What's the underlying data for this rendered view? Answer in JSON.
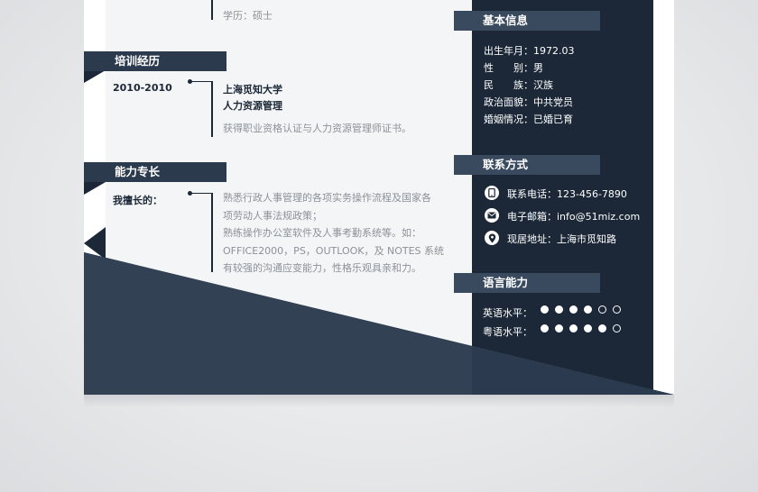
{
  "education": {
    "degree": "学历：硕士"
  },
  "training": {
    "title": "培训经历",
    "date": "2010-2010",
    "school": "上海觅知大学",
    "major": "人力资源管理",
    "desc": "获得职业资格认证与人力资源管理师证书。"
  },
  "skills": {
    "title": "能力专长",
    "label": "我擅长的：",
    "lines": [
      "熟悉行政人事管理的各项实务操作流程及国家各",
      "项劳动人事法规政策；",
      "熟练操作办公室软件及人事考勤系统等。如：",
      "OFFICE2000，PS，OUTLOOK，及 NOTES 系统",
      "有较强的沟通应变能力，性格乐观具亲和力。"
    ]
  },
  "basic": {
    "title": "基本信息",
    "rows": [
      "出生年月：1972.03",
      "性　　别：男",
      "民　　族：汉族",
      "政治面貌：中共党员",
      "婚姻情况：已婚已育"
    ]
  },
  "contact": {
    "title": "联系方式",
    "phone": "联系电话：123-456-7890",
    "email": "电子邮箱：info@51miz.com",
    "address": "现居地址：上海市觅知路",
    "icons": [
      "phone-icon",
      "mail-icon",
      "location-pin-icon"
    ]
  },
  "language": {
    "title": "语言能力",
    "items": [
      {
        "label": "英语水平：",
        "level": 4,
        "max": 6
      },
      {
        "label": "粤语水平：",
        "level": 5,
        "max": 6
      }
    ]
  },
  "colors": {
    "navy": "#1c2838",
    "tab": "#2c3a4d",
    "sidetab": "#3a4a5e",
    "slate": "#334155"
  }
}
